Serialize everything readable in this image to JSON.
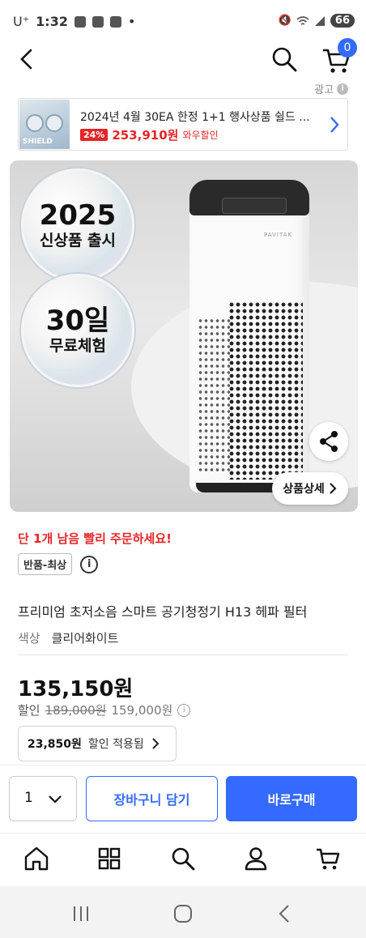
{
  "status_bar": {
    "carrier": "U⁺",
    "time": "1:32",
    "battery": "66"
  },
  "header": {
    "cart_count": "0"
  },
  "ad": {
    "label": "광고",
    "title": "2024년 4월 30EA 한정 1+1 행사상품 쉴드 ...",
    "discount": "24%",
    "price": "253,910원",
    "wow_label": "와우할인",
    "thumb_text": "SHIELD"
  },
  "image": {
    "badge1_big": "2025",
    "badge1_small": "신상품 출시",
    "badge2_big": "30일",
    "badge2_small": "무료체험",
    "brand": "PAVITAK",
    "detail_label": "상품상세"
  },
  "product": {
    "urgent": "단 1개 남음 빨리 주문하세요!",
    "tag": "반품-최상",
    "name": "프리미엄 초저소음 스마트 공기청정기 H13 헤파 필터",
    "color_label": "색상",
    "color_value": "클리어화이트",
    "price": "135,150원",
    "discount_label": "할인",
    "original_price": "189,000원",
    "list_price": "159,000원",
    "coupon_amount": "23,850원",
    "coupon_text": "할인 적용됨"
  },
  "purchase": {
    "quantity": "1",
    "cart_label": "장바구니 담기",
    "buy_label": "바로구매"
  },
  "colors": {
    "accent": "#346aff",
    "sale": "#e52528"
  }
}
